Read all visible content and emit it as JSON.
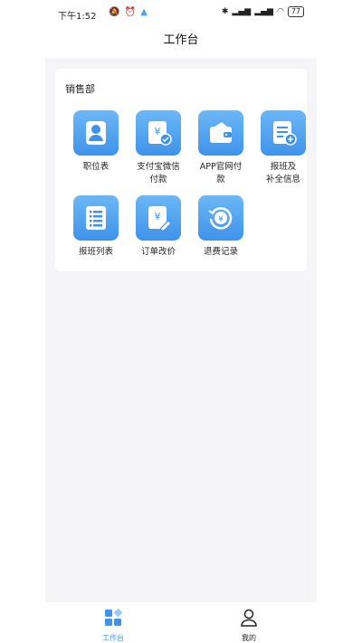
{
  "status_bar": {
    "time": "下午1:52",
    "left_icons": [
      "mute-icon",
      "alarm-icon",
      "notification-icon"
    ],
    "right_icons": [
      "bluetooth-icon",
      "signal-icon",
      "signal-icon",
      "wifi-icon"
    ],
    "battery": "77"
  },
  "header": {
    "title": "工作台"
  },
  "section": {
    "title": "销售部",
    "items": [
      {
        "label": "职位表",
        "icon": "person-icon"
      },
      {
        "label": "支付宝微信付款",
        "icon": "payment-icon"
      },
      {
        "label": "APP官网付款",
        "icon": "wallet-icon"
      },
      {
        "label": "报班及补全信息",
        "icon": "add-document-icon"
      },
      {
        "label": "报班列表",
        "icon": "list-icon"
      },
      {
        "label": "订单改价",
        "icon": "edit-price-icon"
      },
      {
        "label": "退费记录",
        "icon": "refund-icon"
      }
    ]
  },
  "tabbar": {
    "tabs": [
      {
        "label": "工作台",
        "icon": "workbench-icon",
        "active": true
      },
      {
        "label": "我的",
        "icon": "profile-icon",
        "active": false
      }
    ]
  },
  "colors": {
    "accent": "#3e93ea",
    "background": "#f5f5f7"
  }
}
